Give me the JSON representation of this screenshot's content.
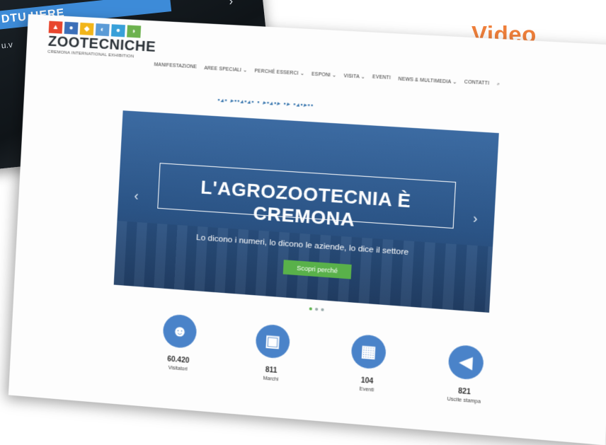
{
  "background_screenshot": {
    "banner_text": "DTU HERE",
    "url_fragment": "u.v"
  },
  "video_label": "Video",
  "site": {
    "logo": {
      "title": "ZOOTECNICHE",
      "subtitle": "CREMONA INTERNATIONAL EXHIBITION",
      "icon_colors": [
        "#e8452d",
        "#3c6fb8",
        "#f2b519",
        "#5b9bd6",
        "#38a0d9",
        "#6db24f"
      ]
    },
    "nav": [
      "MANIFESTAZIONE",
      "AREE SPECIALI ⌄",
      "PERCHÉ ESSERCI ⌄",
      "ESPONI ⌄",
      "VISITA ⌄",
      "EVENTI",
      "NEWS & MULTIMEDIA ⌄",
      "CONTATTI"
    ],
    "hero": {
      "title": "L'AGROZOOTECNIA È CREMONA",
      "subtitle": "Lo dicono i numeri, lo dicono le aziende, lo dice il settore",
      "button": "Scopri perché"
    },
    "stats": [
      {
        "icon": "person-icon",
        "value": "60.420",
        "label": "Visitatori"
      },
      {
        "icon": "briefcase-icon",
        "value": "811",
        "label": "Marchi"
      },
      {
        "icon": "calendar-icon",
        "value": "104",
        "label": "Eventi"
      },
      {
        "icon": "megaphone-icon",
        "value": "821",
        "label": "Uscite stampa"
      }
    ]
  },
  "colors": {
    "accent_orange": "#ef7f3a",
    "hero_blue": "#2b5486",
    "button_green": "#59b14a",
    "stat_blue": "#4a83c9"
  }
}
